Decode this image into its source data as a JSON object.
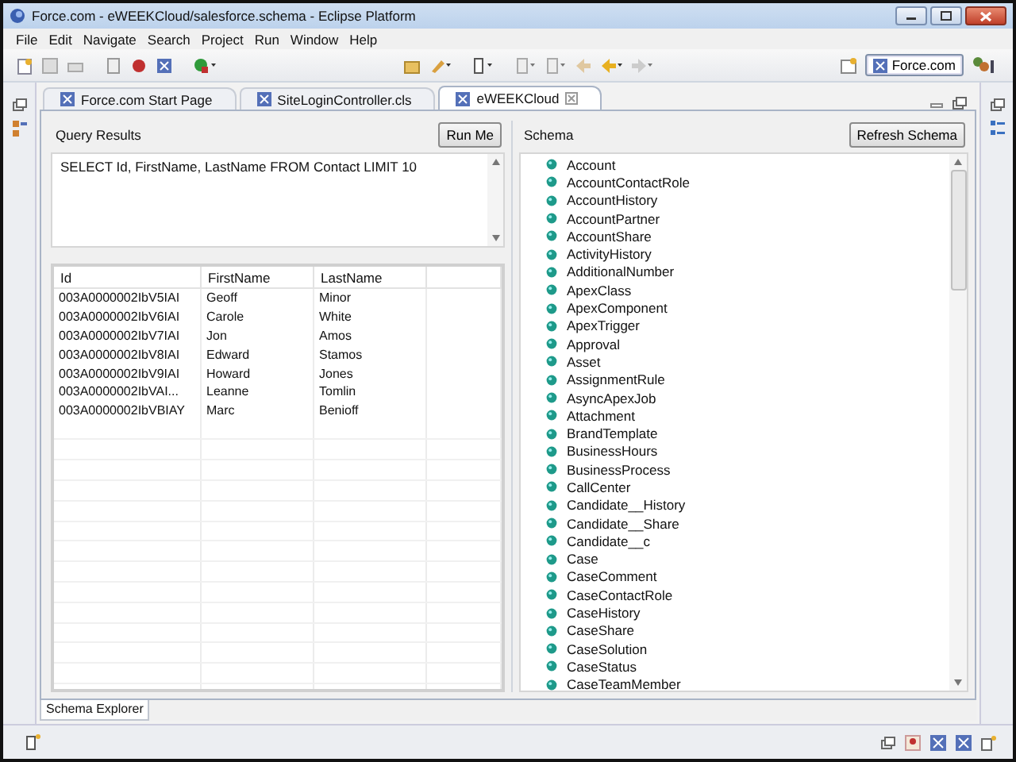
{
  "window": {
    "title": "Force.com - eWEEKCloud/salesforce.schema - Eclipse Platform"
  },
  "menu": [
    "File",
    "Edit",
    "Navigate",
    "Search",
    "Project",
    "Run",
    "Window",
    "Help"
  ],
  "perspective": {
    "label": "Force.com",
    "selected": true
  },
  "editor_tabs": [
    {
      "label": "Force.com Start Page",
      "selected": false
    },
    {
      "label": "SiteLoginController.cls",
      "selected": false
    },
    {
      "label": "eWEEKCloud",
      "selected": true
    }
  ],
  "query_panel": {
    "title": "Query Results",
    "run_button": "Run Me",
    "query": "SELECT Id, FirstName, LastName FROM Contact LIMIT 10",
    "table": {
      "columns": [
        "Id",
        "FirstName",
        "LastName"
      ],
      "rows": [
        [
          "003A0000002IbV5IAI",
          "Geoff",
          "Minor"
        ],
        [
          "003A0000002IbV6IAI",
          "Carole",
          "White"
        ],
        [
          "003A0000002IbV7IAI",
          "Jon",
          "Amos"
        ],
        [
          "003A0000002IbV8IAI",
          "Edward",
          "Stamos"
        ],
        [
          "003A0000002IbV9IAI",
          "Howard",
          "Jones"
        ],
        [
          "003A0000002IbVAI...",
          "Leanne",
          "Tomlin"
        ],
        [
          "003A0000002IbVBIAY",
          "Marc",
          "Benioff"
        ]
      ]
    }
  },
  "schema_panel": {
    "title": "Schema",
    "refresh_button": "Refresh Schema",
    "items": [
      "Account",
      "AccountContactRole",
      "AccountHistory",
      "AccountPartner",
      "AccountShare",
      "ActivityHistory",
      "AdditionalNumber",
      "ApexClass",
      "ApexComponent",
      "ApexTrigger",
      "Approval",
      "Asset",
      "AssignmentRule",
      "AsyncApexJob",
      "Attachment",
      "BrandTemplate",
      "BusinessHours",
      "BusinessProcess",
      "CallCenter",
      "Candidate__History",
      "Candidate__Share",
      "Candidate__c",
      "Case",
      "CaseComment",
      "CaseContactRole",
      "CaseHistory",
      "CaseShare",
      "CaseSolution",
      "CaseStatus",
      "CaseTeamMember"
    ]
  },
  "bottom_tabs": [
    {
      "label": "Schema Explorer",
      "selected": true
    }
  ]
}
